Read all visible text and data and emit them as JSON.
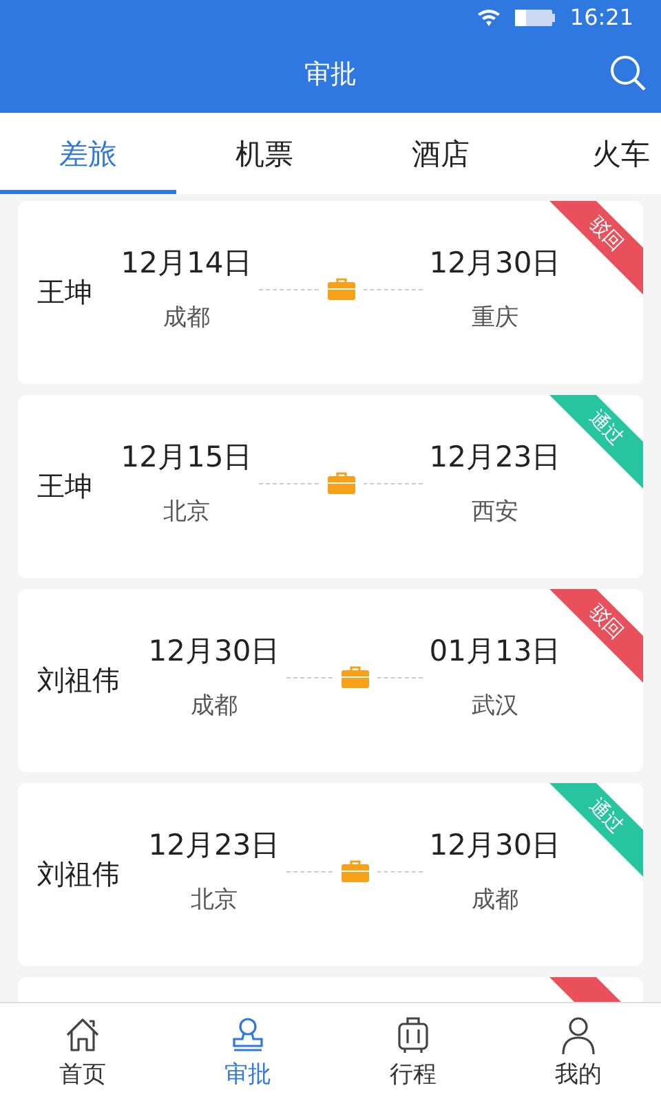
{
  "status_bar": {
    "time": "16:21"
  },
  "header": {
    "title": "审批"
  },
  "tabs": [
    {
      "label": "差旅",
      "selected": true
    },
    {
      "label": "机票",
      "selected": false
    },
    {
      "label": "酒店",
      "selected": false
    },
    {
      "label": "火车",
      "selected": false
    }
  ],
  "trips": [
    {
      "name": "王坤",
      "from_date": "12月14日",
      "from_city": "成都",
      "to_date": "12月30日",
      "to_city": "重庆",
      "kind": "rejected",
      "status_label": "驳回"
    },
    {
      "name": "王坤",
      "from_date": "12月15日",
      "from_city": "北京",
      "to_date": "12月23日",
      "to_city": "西安",
      "kind": "approved",
      "status_label": "通过"
    },
    {
      "name": "刘祖伟",
      "from_date": "12月30日",
      "from_city": "成都",
      "to_date": "01月13日",
      "to_city": "武汉",
      "kind": "rejected",
      "status_label": "驳回"
    },
    {
      "name": "刘祖伟",
      "from_date": "12月23日",
      "from_city": "北京",
      "to_date": "12月30日",
      "to_city": "成都",
      "kind": "approved",
      "status_label": "通过"
    },
    {
      "kind": "rejected"
    }
  ],
  "nav": [
    {
      "kind": "home",
      "label": "首页",
      "selected": false
    },
    {
      "kind": "stamp",
      "label": "审批",
      "selected": true
    },
    {
      "kind": "luggage",
      "label": "行程",
      "selected": false
    },
    {
      "kind": "person",
      "label": "我的",
      "selected": false
    }
  ]
}
